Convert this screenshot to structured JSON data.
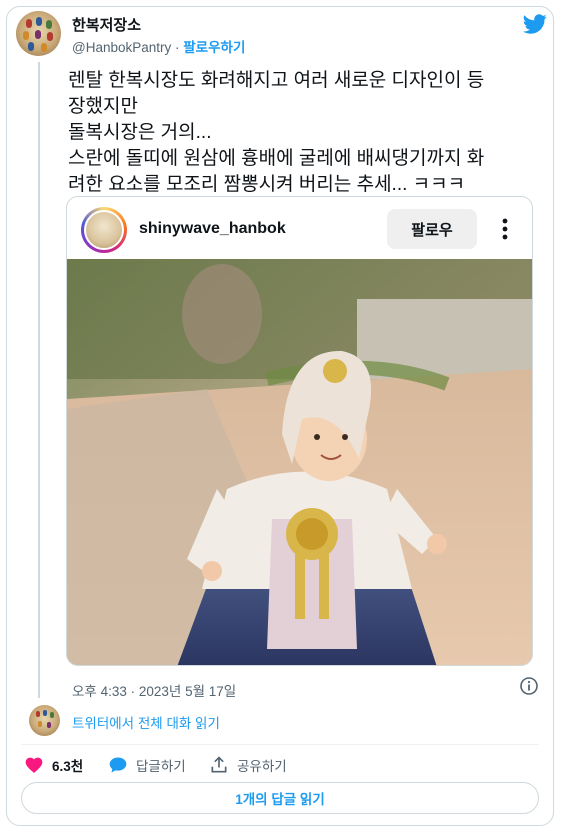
{
  "author": {
    "name": "한복저장소",
    "handle": "@HanbokPantry",
    "separator": " · ",
    "follow_label": "팔로우하기"
  },
  "tweet": {
    "text": "렌탈 한복시장도 화려해지고 여러 새로운 디자인이 등\n장했지만\n돌복시장은 거의...\n스란에 돌띠에 원삼에 흉배에 굴레에 배씨댕기까지 화\n려한 요소를 모조리 짬뽕시켜 버리는 추세... ㅋㅋㅋ",
    "timestamp": "오후 4:33 · 2023년 5월 17일"
  },
  "embed": {
    "username": "shinywave_hanbok",
    "follow_label": "팔로우"
  },
  "thread": {
    "link_label": "트위터에서 전체 대화 읽기"
  },
  "actions": {
    "like_count": "6.3천",
    "reply_label": "답글하기",
    "share_label": "공유하기",
    "read_replies_label": "1개의 답글 읽기"
  },
  "colors": {
    "accent": "#1d9bf0",
    "like": "#f91880",
    "text": "#0f1419",
    "secondary": "#536471",
    "border": "#cfd9de"
  },
  "icons": [
    "twitter-bird-icon",
    "more-dots-icon",
    "info-icon",
    "heart-icon",
    "reply-bubble-icon",
    "share-upload-icon"
  ]
}
